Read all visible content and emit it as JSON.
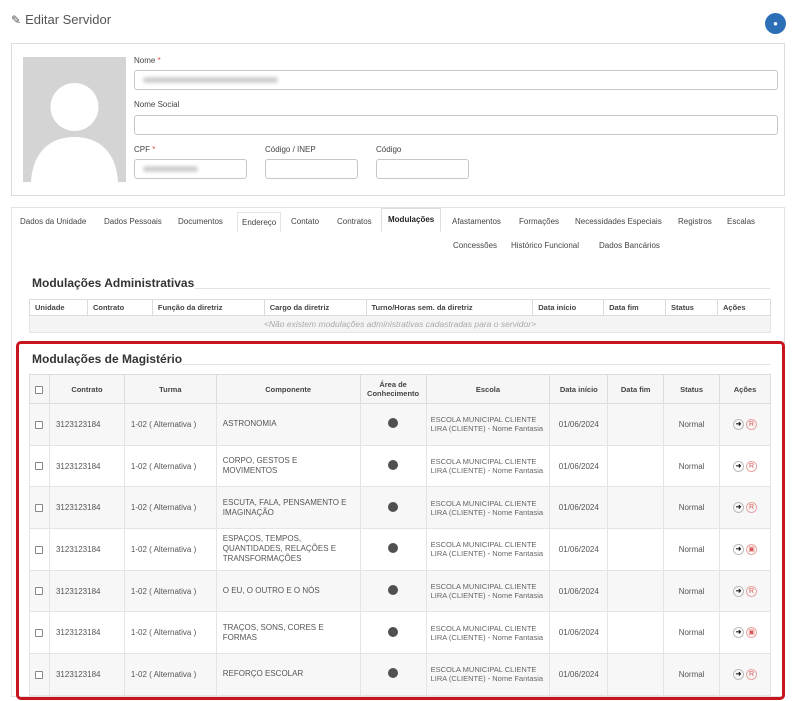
{
  "header": {
    "title": "Editar Servidor",
    "edit_icon": "edit-icon",
    "avatar_icon": "user-icon"
  },
  "profile": {
    "nome_label": "Nome",
    "nome_social_label": "Nome Social",
    "cpf_label": "CPF",
    "inep_label": "Código / INEP",
    "codigo_label": "Código",
    "required_mark": "*",
    "nome_value": "",
    "nome_social_value": "",
    "cpf_value": "",
    "inep_value": "",
    "codigo_value": ""
  },
  "tabs": {
    "row1": [
      "Dados da Unidade",
      "Dados Pessoais",
      "Documentos",
      "Endereço",
      "Contato",
      "Contratos",
      "Modulações",
      "Afastamentos",
      "Formações",
      "Necessidades Especiais",
      "Registros",
      "Escalas"
    ],
    "row2": [
      "Concessões",
      "Histórico Funcional",
      "Dados Bancários"
    ],
    "active": "Modulações"
  },
  "admin": {
    "title": "Modulações Administrativas",
    "columns": [
      "Unidade",
      "Contrato",
      "Função da diretriz",
      "Cargo da diretriz",
      "Turno/Horas sem. da diretriz",
      "Data início",
      "Data fim",
      "Status",
      "Ações"
    ],
    "empty": "<Não existem modulações administrativas cadastradas para o servidor>"
  },
  "magisterio": {
    "title": "Modulações de Magistério",
    "columns": [
      "Contrato",
      "Turma",
      "Componente",
      "Área de Conhecimento",
      "Escola",
      "Data início",
      "Data fim",
      "Status",
      "Ações"
    ],
    "rows": [
      {
        "contrato": "3123123184",
        "turma": "1-02 ( Alternativa )",
        "componente": "ASTRONOMIA",
        "escola": "ESCOLA MUNICIPAL CLIENTE LIRA (CLIENTE) - Nome Fantasia",
        "inicio": "01/06/2024",
        "fim": "",
        "status": "Normal",
        "delete_icon": "R"
      },
      {
        "contrato": "3123123184",
        "turma": "1-02 ( Alternativa )",
        "componente": "CORPO, GESTOS E MOVIMENTOS",
        "escola": "ESCOLA MUNICIPAL CLIENTE LIRA (CLIENTE) - Nome Fantasia",
        "inicio": "01/06/2024",
        "fim": "",
        "status": "Normal",
        "delete_icon": "R"
      },
      {
        "contrato": "3123123184",
        "turma": "1-02 ( Alternativa )",
        "componente": "ESCUTA, FALA, PENSAMENTO E IMAGINAÇÃO",
        "escola": "ESCOLA MUNICIPAL CLIENTE LIRA (CLIENTE) - Nome Fantasia",
        "inicio": "01/06/2024",
        "fim": "",
        "status": "Normal",
        "delete_icon": "R"
      },
      {
        "contrato": "3123123184",
        "turma": "1-02 ( Alternativa )",
        "componente": "ESPAÇOS, TEMPOS, QUANTIDADES, RELAÇÕES E TRANSFORMAÇÕES",
        "escola": "ESCOLA MUNICIPAL CLIENTE LIRA (CLIENTE) - Nome Fantasia",
        "inicio": "01/06/2024",
        "fim": "",
        "status": "Normal",
        "delete_icon": "trash"
      },
      {
        "contrato": "3123123184",
        "turma": "1-02 ( Alternativa )",
        "componente": "O EU, O OUTRO E O NÓS",
        "escola": "ESCOLA MUNICIPAL CLIENTE LIRA (CLIENTE) - Nome Fantasia",
        "inicio": "01/06/2024",
        "fim": "",
        "status": "Normal",
        "delete_icon": "R"
      },
      {
        "contrato": "3123123184",
        "turma": "1-02 ( Alternativa )",
        "componente": "TRAÇOS, SONS, CORES E FORMAS",
        "escola": "ESCOLA MUNICIPAL CLIENTE LIRA (CLIENTE) - Nome Fantasia",
        "inicio": "01/06/2024",
        "fim": "",
        "status": "Normal",
        "delete_icon": "trash"
      },
      {
        "contrato": "3123123184",
        "turma": "1-02 ( Alternativa )",
        "componente": "REFORÇO ESCOLAR",
        "escola": "ESCOLA MUNICIPAL CLIENTE LIRA (CLIENTE) - Nome Fantasia",
        "inicio": "01/06/2024",
        "fim": "",
        "status": "Normal",
        "delete_icon": "R"
      }
    ]
  },
  "colors": {
    "highlight": "#c8141c",
    "avatar": "#2c6fb7",
    "required": "#d9534f"
  }
}
